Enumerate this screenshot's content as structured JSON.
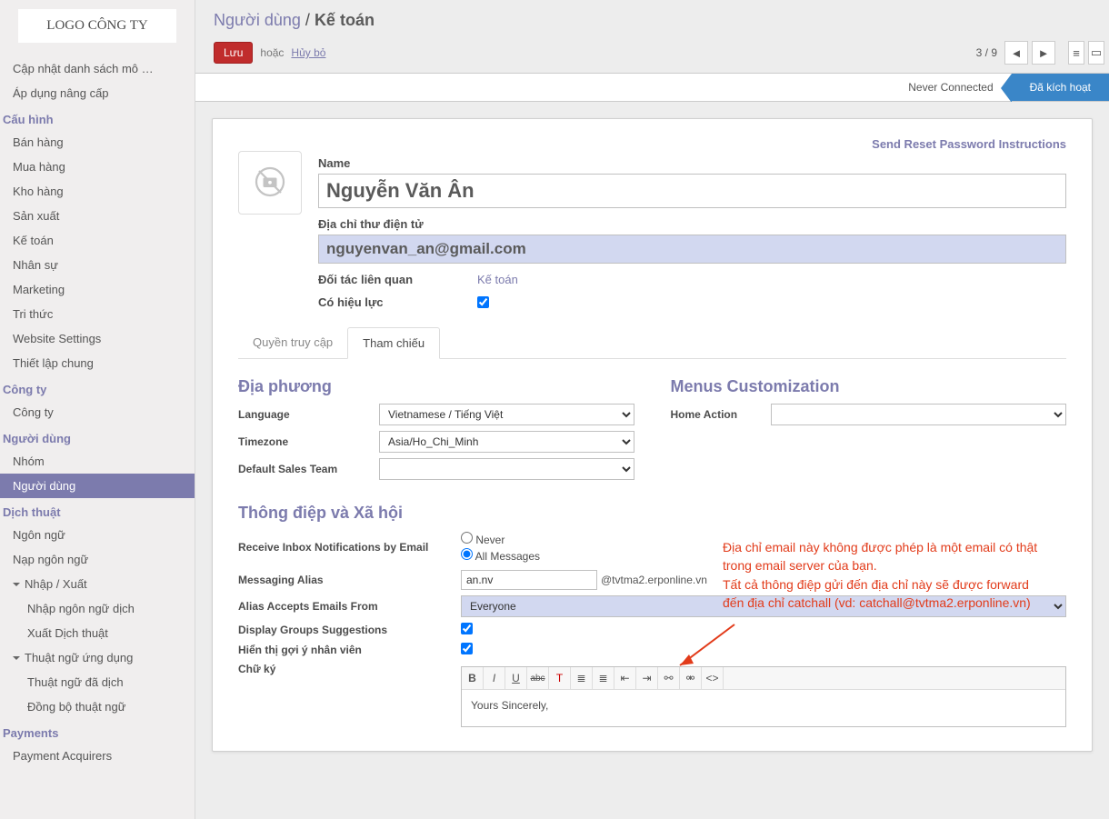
{
  "logo": "LOGO CÔNG TY",
  "sidebar": {
    "items": [
      {
        "type": "item",
        "label": "Cập nhật danh sách mô …"
      },
      {
        "type": "item",
        "label": "Áp dụng nâng cấp"
      },
      {
        "type": "header",
        "label": "Cấu hình"
      },
      {
        "type": "item",
        "label": "Bán hàng"
      },
      {
        "type": "item",
        "label": "Mua hàng"
      },
      {
        "type": "item",
        "label": "Kho hàng"
      },
      {
        "type": "item",
        "label": "Sản xuất"
      },
      {
        "type": "item",
        "label": "Kế toán"
      },
      {
        "type": "item",
        "label": "Nhân sự"
      },
      {
        "type": "item",
        "label": "Marketing"
      },
      {
        "type": "item",
        "label": "Tri thức"
      },
      {
        "type": "item",
        "label": "Website Settings"
      },
      {
        "type": "item",
        "label": "Thiết lập chung"
      },
      {
        "type": "header",
        "label": "Công ty"
      },
      {
        "type": "item",
        "label": "Công ty"
      },
      {
        "type": "header",
        "label": "Người dùng"
      },
      {
        "type": "item",
        "label": "Nhóm"
      },
      {
        "type": "item",
        "label": "Người dùng",
        "active": true
      },
      {
        "type": "header",
        "label": "Dịch thuật"
      },
      {
        "type": "item",
        "label": "Ngôn ngữ"
      },
      {
        "type": "item",
        "label": "Nạp ngôn ngữ"
      },
      {
        "type": "caret",
        "label": "Nhập / Xuất"
      },
      {
        "type": "sub",
        "label": "Nhập ngôn ngữ dịch"
      },
      {
        "type": "sub",
        "label": "Xuất Dịch thuật"
      },
      {
        "type": "caret",
        "label": "Thuật ngữ ứng dụng"
      },
      {
        "type": "sub",
        "label": "Thuật ngữ đã dịch"
      },
      {
        "type": "sub",
        "label": "Đồng bộ thuật ngữ"
      },
      {
        "type": "header",
        "label": "Payments"
      },
      {
        "type": "item",
        "label": "Payment Acquirers"
      }
    ]
  },
  "breadcrumb": {
    "parent": "Người dùng",
    "current": "Kế toán"
  },
  "toolbar": {
    "save": "Lưu",
    "or": "hoặc",
    "cancel": "Hủy bỏ",
    "pager": "3 / 9"
  },
  "statusbar": {
    "step1": "Never Connected",
    "step2": "Đã kích hoạt"
  },
  "sheet": {
    "reset_link": "Send Reset Password Instructions",
    "name_label": "Name",
    "name_value": "Nguyễn Văn Ân",
    "email_label": "Địa chỉ thư điện tử",
    "email_value": "nguyenvan_an@gmail.com",
    "partner_label": "Đối tác liên quan",
    "partner_value": "Kế toán",
    "active_label": "Có hiệu lực",
    "tabs": {
      "access": "Quyền truy cập",
      "prefs": "Tham chiếu"
    },
    "loc_title": "Địa phương",
    "lang_label": "Language",
    "lang_value": "Vietnamese / Tiếng Việt",
    "tz_label": "Timezone",
    "tz_value": "Asia/Ho_Chi_Minh",
    "team_label": "Default Sales Team",
    "menus_title": "Menus Customization",
    "home_label": "Home Action",
    "msg_title": "Thông điệp và Xã hội",
    "inbox_label": "Receive Inbox Notifications by Email",
    "inbox_never": "Never",
    "inbox_all": "All Messages",
    "alias_label": "Messaging Alias",
    "alias_value": "an.nv",
    "alias_domain": "@tvtma2.erponline.vn",
    "alias_accept_label": "Alias Accepts Emails From",
    "alias_accept_value": "Everyone",
    "groups_label": "Display Groups Suggestions",
    "emp_label": "Hiển thị gợi ý nhân viên",
    "sig_label": "Chữ ký",
    "sig_body": "Yours Sincerely,"
  },
  "annotation": {
    "line1": "Địa chỉ email này không được phép là một email có thật trong email server của bạn.",
    "line2": "Tất cả thông điệp gửi đến địa chỉ này sẽ được forward đến địa chỉ catchall (vd: catchall@tvtma2.erponline.vn)"
  },
  "rte_icons": [
    "B",
    "I",
    "U",
    "abc",
    "T",
    "≣",
    "≣",
    "⇤",
    "⇥",
    "⚯",
    "⚮",
    "<>"
  ]
}
